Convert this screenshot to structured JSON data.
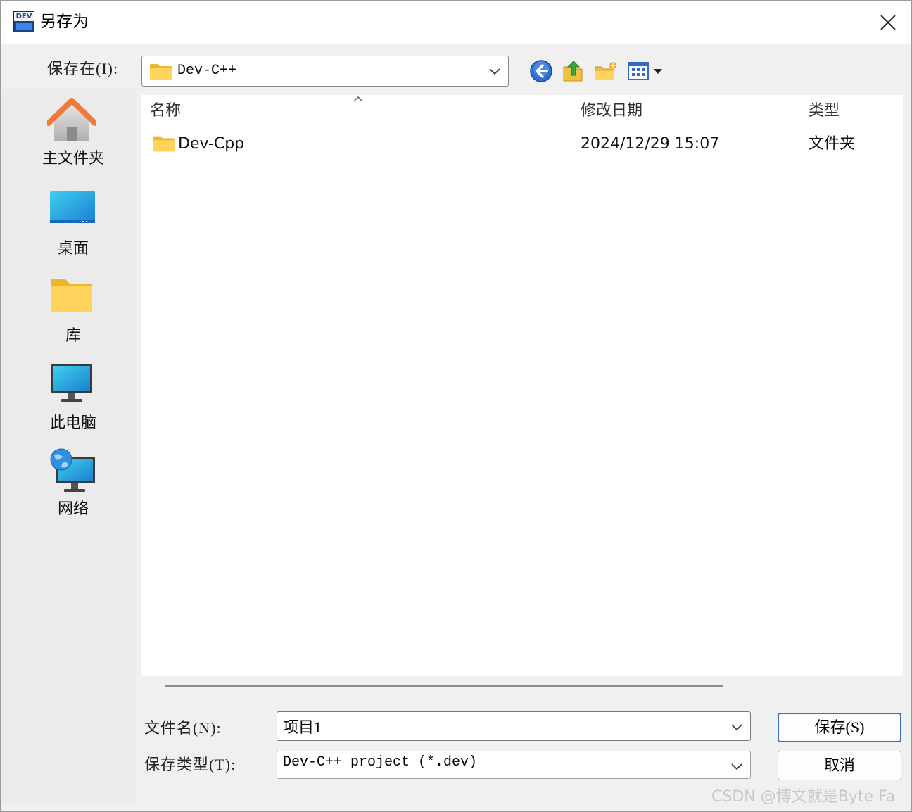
{
  "window": {
    "title": "另存为",
    "app_icon_text": "DEV"
  },
  "save_in": {
    "label": "保存在(I):",
    "value": "Dev-C++"
  },
  "toolbar": {
    "icons": [
      "back-icon",
      "up-folder-icon",
      "new-folder-icon",
      "view-menu-icon"
    ]
  },
  "places": [
    {
      "label": "主文件夹",
      "icon": "home-icon"
    },
    {
      "label": "桌面",
      "icon": "desktop-icon"
    },
    {
      "label": "库",
      "icon": "library-folder-icon"
    },
    {
      "label": "此电脑",
      "icon": "this-pc-icon"
    },
    {
      "label": "网络",
      "icon": "network-icon"
    }
  ],
  "file_list": {
    "columns": [
      "名称",
      "修改日期",
      "类型"
    ],
    "rows": [
      {
        "name": "Dev-Cpp",
        "modified": "2024/12/29 15:07",
        "type": "文件夹"
      }
    ]
  },
  "filename": {
    "label": "文件名(N):",
    "value": "项目1"
  },
  "filetype": {
    "label": "保存类型(T):",
    "value": "Dev-C++ project (*.dev)"
  },
  "buttons": {
    "save": "保存(S)",
    "cancel": "取消"
  },
  "watermark": "CSDN @博文就是Byte Fa",
  "colors": {
    "folder_yellow": "#f8c94a",
    "accent_blue": "#3b6fc4",
    "home_orange": "#f07a3a"
  }
}
